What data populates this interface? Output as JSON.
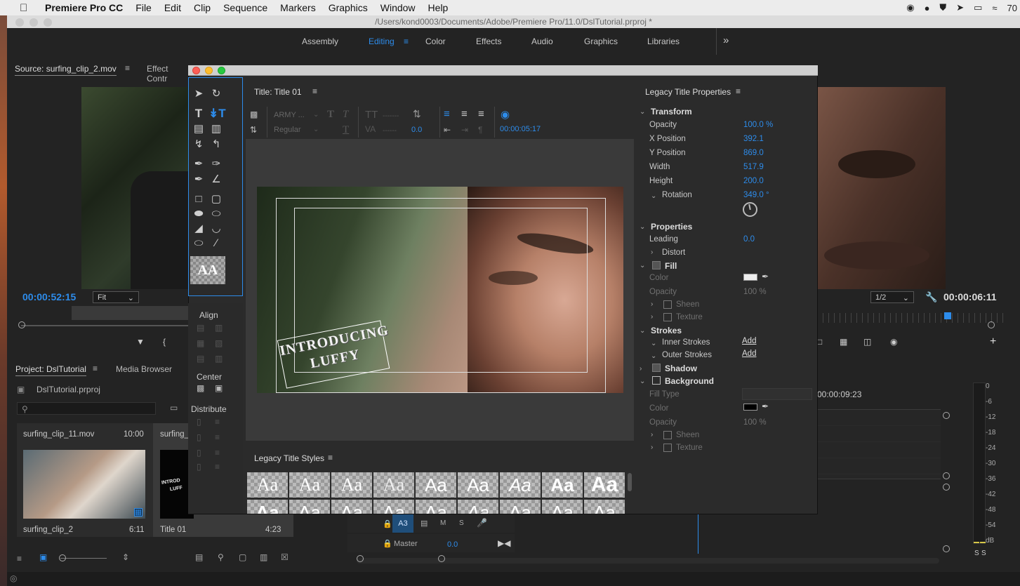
{
  "menubar": {
    "app": "Premiere Pro CC",
    "items": [
      "File",
      "Edit",
      "Clip",
      "Sequence",
      "Markers",
      "Graphics",
      "Window",
      "Help"
    ],
    "battery": "70"
  },
  "window_title": "/Users/kond0003/Documents/Adobe/Premiere Pro/11.0/DslTutorial.prproj *",
  "workspaces": {
    "tabs": [
      "Assembly",
      "Editing",
      "Color",
      "Effects",
      "Audio",
      "Graphics",
      "Libraries"
    ],
    "active": "Editing",
    "more": "»"
  },
  "source_monitor": {
    "tab_source": "Source: surfing_clip_2.mov",
    "tab_effects": "Effect Contr",
    "timecode": "00:00:52:15",
    "zoom": "Fit"
  },
  "program_monitor": {
    "resolution": "1/2",
    "timecode": "00:00:06:11"
  },
  "title_dialog": {
    "title_tab": "Title: Title 01",
    "font": "ARMY ...",
    "font_style": "Regular",
    "kerning_value": "0.0",
    "timecode": "00:00:05:17",
    "styles_header": "Legacy Title Styles",
    "style_sample": "Aa",
    "title_line1": "INTRODUCING",
    "title_line2": "LUFFY"
  },
  "tools": {
    "align_label": "Align",
    "center_label": "Center",
    "distribute_label": "Distribute",
    "preview_glyph": "AA"
  },
  "properties": {
    "header": "Legacy Title Properties",
    "transform": "Transform",
    "opacity_label": "Opacity",
    "opacity_val": "100.0 %",
    "xpos_label": "X Position",
    "xpos_val": "392.1",
    "ypos_label": "Y Position",
    "ypos_val": "869.0",
    "width_label": "Width",
    "width_val": "517.9",
    "height_label": "Height",
    "height_val": "200.0",
    "rotation_label": "Rotation",
    "rotation_val": "349.0 °",
    "properties_section": "Properties",
    "leading_label": "Leading",
    "leading_val": "0.0",
    "distort_label": "Distort",
    "fill_label": "Fill",
    "color_label": "Color",
    "fill_opacity_label": "Opacity",
    "fill_opacity_val": "100 %",
    "sheen_label": "Sheen",
    "texture_label": "Texture",
    "strokes_label": "Strokes",
    "inner_strokes": "Inner Strokes",
    "outer_strokes": "Outer Strokes",
    "add": "Add",
    "shadow_label": "Shadow",
    "background_label": "Background",
    "fill_type_label": "Fill Type",
    "bg_color_label": "Color",
    "bg_opacity_label": "Opacity",
    "bg_opacity_val": "100 %",
    "bg_sheen": "Sheen",
    "bg_texture": "Texture"
  },
  "project": {
    "tab_project": "Project: DslTutorial",
    "tab_media": "Media Browser",
    "file": "DslTutorial.prproj",
    "clips": [
      {
        "name_top": "surfing_clip_11.mov",
        "dur_top": "10:00",
        "name": "surfing_clip_2",
        "dur": "6:11"
      },
      {
        "name_top": "surfing_",
        "dur_top": "",
        "name": "Title 01",
        "dur": "4:23"
      }
    ],
    "thumb_text_1": "INTROD",
    "thumb_text_2": "LUFF"
  },
  "timeline": {
    "timecode": "00:00:09:23",
    "track_a3": "A3",
    "m": "M",
    "s": "S",
    "master": "Master",
    "master_val": "0.0"
  },
  "meter": {
    "labels": [
      "0",
      "-6",
      "-12",
      "-18",
      "-24",
      "-30",
      "-36",
      "-42",
      "-48",
      "-54",
      "dB"
    ],
    "solo": [
      "S",
      "S"
    ]
  },
  "colors": {
    "accent": "#2d8ceb",
    "panel": "#232323",
    "dialog": "#2b2b2b"
  }
}
